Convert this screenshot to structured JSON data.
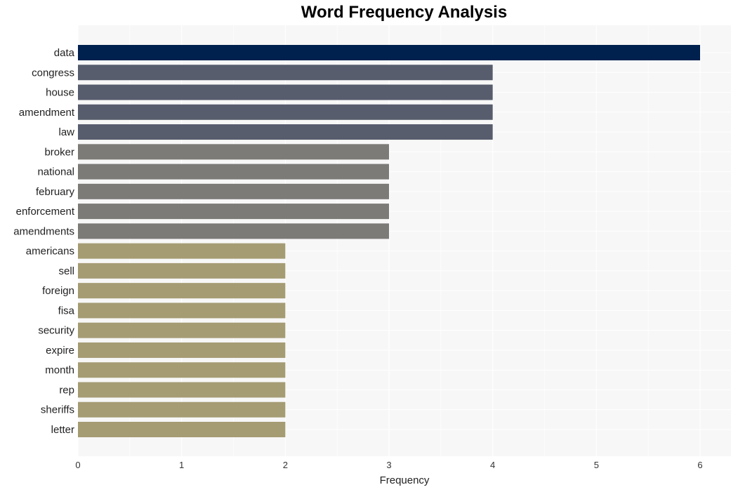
{
  "chart_data": {
    "type": "bar",
    "orientation": "horizontal",
    "title": "Word Frequency Analysis",
    "xlabel": "Frequency",
    "ylabel": "",
    "xlim": [
      0,
      6.3
    ],
    "xticks": [
      0,
      1,
      2,
      3,
      4,
      5,
      6
    ],
    "grid": true,
    "categories": [
      "data",
      "congress",
      "house",
      "amendment",
      "law",
      "broker",
      "national",
      "february",
      "enforcement",
      "amendments",
      "americans",
      "sell",
      "foreign",
      "fisa",
      "security",
      "expire",
      "month",
      "rep",
      "sheriffs",
      "letter"
    ],
    "values": [
      6,
      4,
      4,
      4,
      4,
      3,
      3,
      3,
      3,
      3,
      2,
      2,
      2,
      2,
      2,
      2,
      2,
      2,
      2,
      2
    ],
    "colors": {
      "6": "#00204e",
      "4": "#575d6d",
      "3": "#7c7b78",
      "2": "#a59c74"
    },
    "background": "#f7f7f7"
  }
}
